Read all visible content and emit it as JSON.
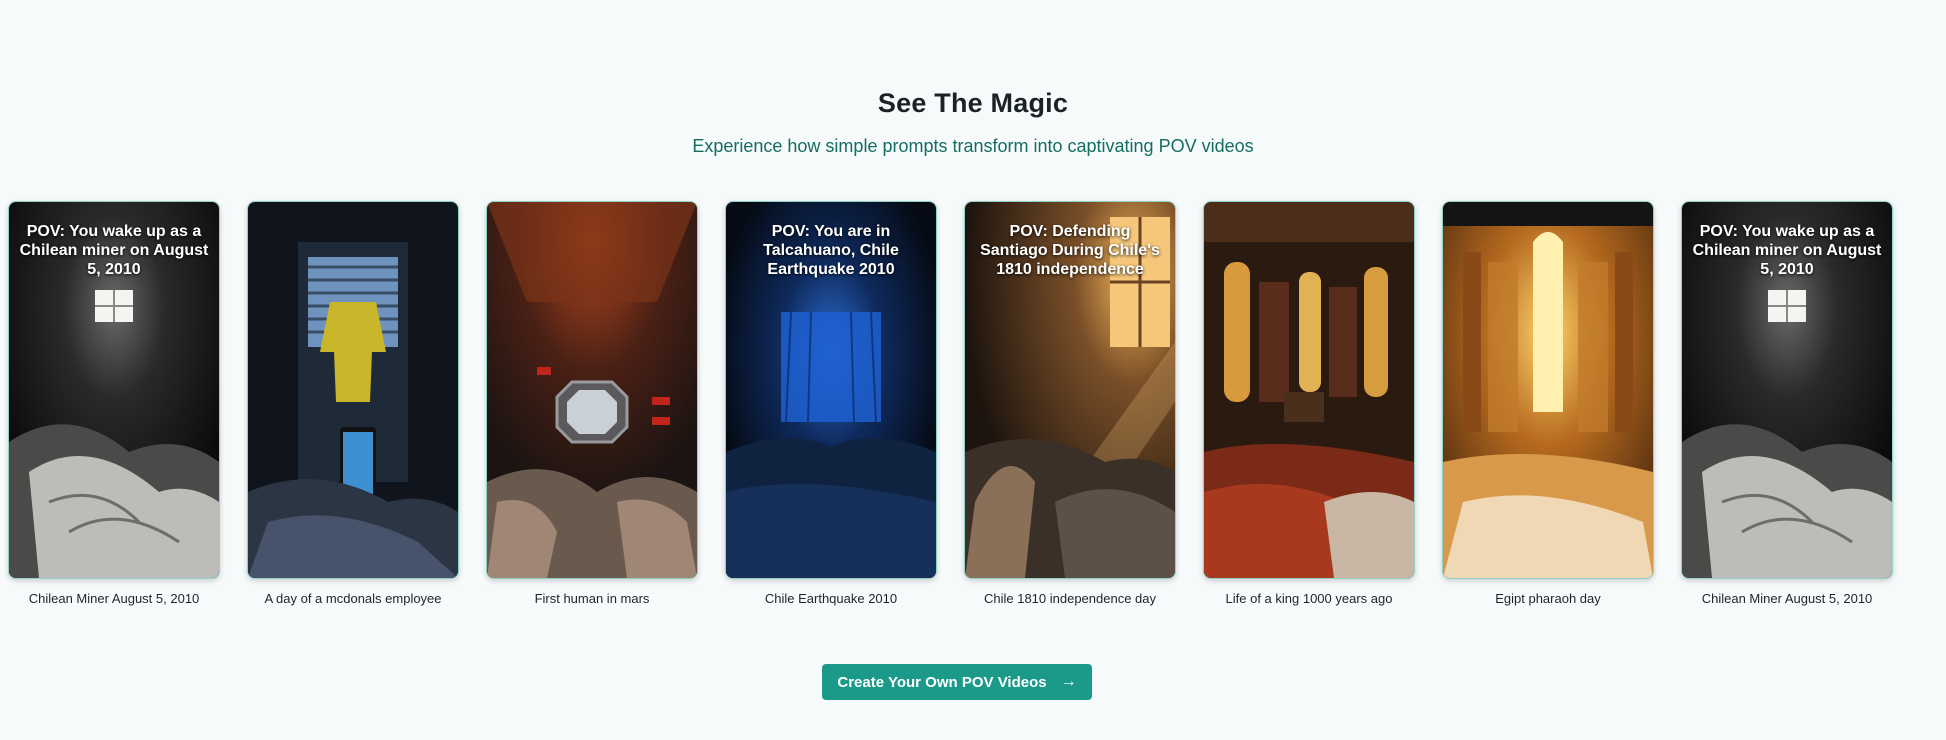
{
  "section": {
    "title": "See The Magic",
    "subtitle": "Experience how simple prompts transform into captivating POV videos"
  },
  "cards": [
    {
      "overlay": "POV: You wake up as a Chilean miner on August 5, 2010",
      "caption": "Chilean Miner August 5, 2010"
    },
    {
      "overlay": "",
      "caption": "A day of a mcdonals employee"
    },
    {
      "overlay": "",
      "caption": "First human in mars"
    },
    {
      "overlay": "POV: You are in Talcahuano, Chile Earthquake 2010",
      "caption": "Chile Earthquake 2010"
    },
    {
      "overlay": "POV: Defending Santiago During Chile's 1810 independence",
      "caption": "Chile 1810 independence day"
    },
    {
      "overlay": "",
      "caption": "Life of a king 1000 years ago"
    },
    {
      "overlay": "",
      "caption": "Egipt pharaoh day"
    },
    {
      "overlay": "POV: You wake up as a Chilean miner on August 5, 2010",
      "caption": "Chilean Miner August 5, 2010"
    }
  ],
  "cta": {
    "label": "Create Your Own POV Videos",
    "icon": "arrow-right-icon"
  },
  "colors": {
    "accent": "#1b9a8a",
    "subtitle": "#156d62",
    "background": "#f6fafb"
  }
}
